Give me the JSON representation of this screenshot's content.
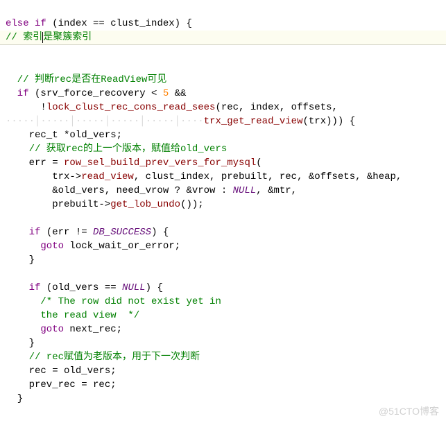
{
  "code": {
    "l1a": "else if",
    "l1b": " (index == clust_index) {",
    "l2a": "// 索引",
    "l2b": "是聚簇索引",
    "l4": "  // 判断rec是否在ReadView可见",
    "l5a": "  if",
    "l5b": " (srv_force_recovery < ",
    "l5n": "5",
    "l5c": " &&",
    "l6a": "      !",
    "l6fn": "lock_clust_rec_cons_read_sees",
    "l6b": "(rec, index, offsets,",
    "l7ws": "·····│·····│·····│·····│·····│····",
    "l7fn": "trx_get_read_view",
    "l7b": "(trx))) {",
    "l8": "    rec_t *old_vers;",
    "l9": "    // 获取rec的上一个版本，赋值给old_vers",
    "l10a": "    err = ",
    "l10fn": "row_sel_build_prev_vers_for_mysql",
    "l10b": "(",
    "l11a": "        trx->",
    "l11m": "read_view",
    "l11b": ", clust_index, prebuilt, rec, &offsets, &heap,",
    "l12a": "        &old_vers, need_vrow ? &vrow : ",
    "l12n": "NULL",
    "l12b": ", &mtr,",
    "l13a": "        prebuilt->",
    "l13fn": "get_lob_undo",
    "l13b": "());",
    "l15a": "    if",
    "l15b": " (err != ",
    "l15c": "DB_SUCCESS",
    "l15d": ") {",
    "l16a": "      goto",
    "l16b": " lock_wait_or_error;",
    "l17": "    }",
    "l19a": "    if",
    "l19b": " (old_vers == ",
    "l19n": "NULL",
    "l19c": ") {",
    "l20": "      /* The row did not exist yet in",
    "l21": "      the read view  */",
    "l22a": "      goto",
    "l22b": " next_rec;",
    "l23": "    }",
    "l24": "    // rec赋值为老版本，用于下一次判断",
    "l25": "    rec = old_vers;",
    "l26": "    prev_rec = rec;",
    "l27": "  }"
  },
  "watermark": "@51CTO博客"
}
